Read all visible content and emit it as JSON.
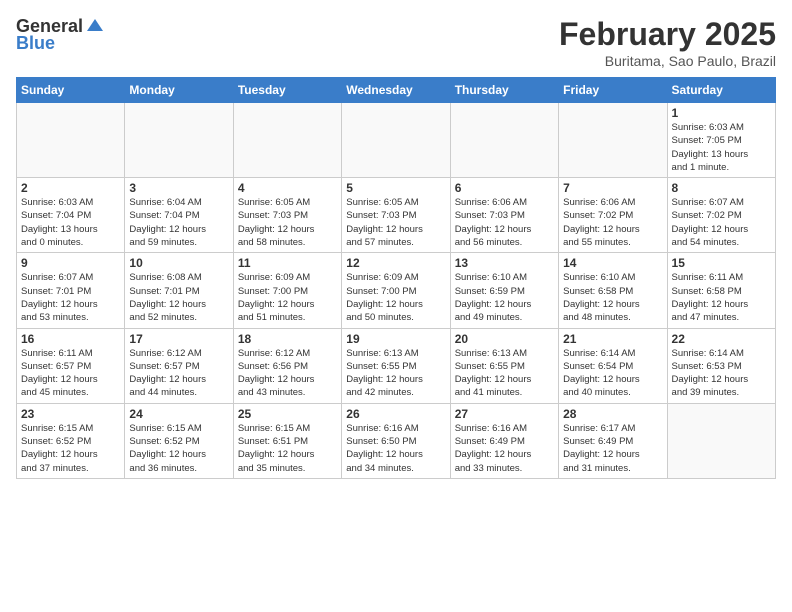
{
  "header": {
    "logo_general": "General",
    "logo_blue": "Blue",
    "title": "February 2025",
    "subtitle": "Buritama, Sao Paulo, Brazil"
  },
  "days_of_week": [
    "Sunday",
    "Monday",
    "Tuesday",
    "Wednesday",
    "Thursday",
    "Friday",
    "Saturday"
  ],
  "weeks": [
    [
      {
        "day": "",
        "info": ""
      },
      {
        "day": "",
        "info": ""
      },
      {
        "day": "",
        "info": ""
      },
      {
        "day": "",
        "info": ""
      },
      {
        "day": "",
        "info": ""
      },
      {
        "day": "",
        "info": ""
      },
      {
        "day": "1",
        "info": "Sunrise: 6:03 AM\nSunset: 7:05 PM\nDaylight: 13 hours\nand 1 minute."
      }
    ],
    [
      {
        "day": "2",
        "info": "Sunrise: 6:03 AM\nSunset: 7:04 PM\nDaylight: 13 hours\nand 0 minutes."
      },
      {
        "day": "3",
        "info": "Sunrise: 6:04 AM\nSunset: 7:04 PM\nDaylight: 12 hours\nand 59 minutes."
      },
      {
        "day": "4",
        "info": "Sunrise: 6:05 AM\nSunset: 7:03 PM\nDaylight: 12 hours\nand 58 minutes."
      },
      {
        "day": "5",
        "info": "Sunrise: 6:05 AM\nSunset: 7:03 PM\nDaylight: 12 hours\nand 57 minutes."
      },
      {
        "day": "6",
        "info": "Sunrise: 6:06 AM\nSunset: 7:03 PM\nDaylight: 12 hours\nand 56 minutes."
      },
      {
        "day": "7",
        "info": "Sunrise: 6:06 AM\nSunset: 7:02 PM\nDaylight: 12 hours\nand 55 minutes."
      },
      {
        "day": "8",
        "info": "Sunrise: 6:07 AM\nSunset: 7:02 PM\nDaylight: 12 hours\nand 54 minutes."
      }
    ],
    [
      {
        "day": "9",
        "info": "Sunrise: 6:07 AM\nSunset: 7:01 PM\nDaylight: 12 hours\nand 53 minutes."
      },
      {
        "day": "10",
        "info": "Sunrise: 6:08 AM\nSunset: 7:01 PM\nDaylight: 12 hours\nand 52 minutes."
      },
      {
        "day": "11",
        "info": "Sunrise: 6:09 AM\nSunset: 7:00 PM\nDaylight: 12 hours\nand 51 minutes."
      },
      {
        "day": "12",
        "info": "Sunrise: 6:09 AM\nSunset: 7:00 PM\nDaylight: 12 hours\nand 50 minutes."
      },
      {
        "day": "13",
        "info": "Sunrise: 6:10 AM\nSunset: 6:59 PM\nDaylight: 12 hours\nand 49 minutes."
      },
      {
        "day": "14",
        "info": "Sunrise: 6:10 AM\nSunset: 6:58 PM\nDaylight: 12 hours\nand 48 minutes."
      },
      {
        "day": "15",
        "info": "Sunrise: 6:11 AM\nSunset: 6:58 PM\nDaylight: 12 hours\nand 47 minutes."
      }
    ],
    [
      {
        "day": "16",
        "info": "Sunrise: 6:11 AM\nSunset: 6:57 PM\nDaylight: 12 hours\nand 45 minutes."
      },
      {
        "day": "17",
        "info": "Sunrise: 6:12 AM\nSunset: 6:57 PM\nDaylight: 12 hours\nand 44 minutes."
      },
      {
        "day": "18",
        "info": "Sunrise: 6:12 AM\nSunset: 6:56 PM\nDaylight: 12 hours\nand 43 minutes."
      },
      {
        "day": "19",
        "info": "Sunrise: 6:13 AM\nSunset: 6:55 PM\nDaylight: 12 hours\nand 42 minutes."
      },
      {
        "day": "20",
        "info": "Sunrise: 6:13 AM\nSunset: 6:55 PM\nDaylight: 12 hours\nand 41 minutes."
      },
      {
        "day": "21",
        "info": "Sunrise: 6:14 AM\nSunset: 6:54 PM\nDaylight: 12 hours\nand 40 minutes."
      },
      {
        "day": "22",
        "info": "Sunrise: 6:14 AM\nSunset: 6:53 PM\nDaylight: 12 hours\nand 39 minutes."
      }
    ],
    [
      {
        "day": "23",
        "info": "Sunrise: 6:15 AM\nSunset: 6:52 PM\nDaylight: 12 hours\nand 37 minutes."
      },
      {
        "day": "24",
        "info": "Sunrise: 6:15 AM\nSunset: 6:52 PM\nDaylight: 12 hours\nand 36 minutes."
      },
      {
        "day": "25",
        "info": "Sunrise: 6:15 AM\nSunset: 6:51 PM\nDaylight: 12 hours\nand 35 minutes."
      },
      {
        "day": "26",
        "info": "Sunrise: 6:16 AM\nSunset: 6:50 PM\nDaylight: 12 hours\nand 34 minutes."
      },
      {
        "day": "27",
        "info": "Sunrise: 6:16 AM\nSunset: 6:49 PM\nDaylight: 12 hours\nand 33 minutes."
      },
      {
        "day": "28",
        "info": "Sunrise: 6:17 AM\nSunset: 6:49 PM\nDaylight: 12 hours\nand 31 minutes."
      },
      {
        "day": "",
        "info": ""
      }
    ]
  ]
}
